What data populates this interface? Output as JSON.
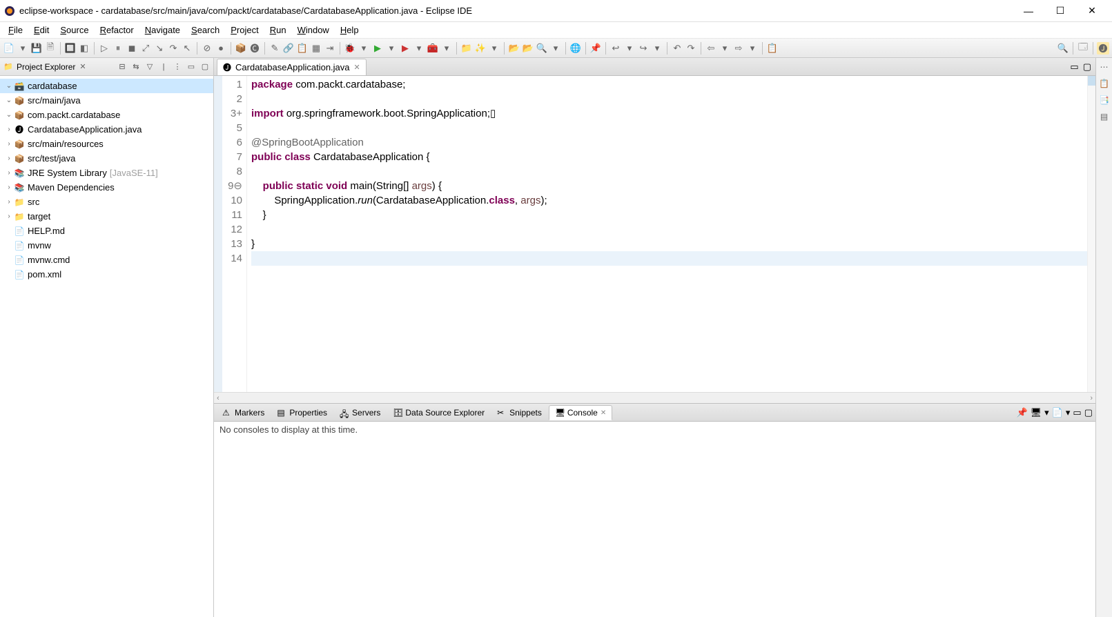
{
  "window": {
    "title": "eclipse-workspace - cardatabase/src/main/java/com/packt/cardatabase/CardatabaseApplication.java - Eclipse IDE"
  },
  "menubar": [
    "File",
    "Edit",
    "Source",
    "Refactor",
    "Navigate",
    "Search",
    "Project",
    "Run",
    "Window",
    "Help"
  ],
  "sidebar": {
    "title": "Project Explorer",
    "nodes": [
      {
        "d": 0,
        "t": "v",
        "icon": "project",
        "label": "cardatabase",
        "sel": true
      },
      {
        "d": 1,
        "t": "v",
        "icon": "srcfolder",
        "label": "src/main/java"
      },
      {
        "d": 2,
        "t": "v",
        "icon": "package",
        "label": "com.packt.cardatabase"
      },
      {
        "d": 3,
        "t": ">",
        "icon": "java",
        "label": "CardatabaseApplication.java"
      },
      {
        "d": 1,
        "t": ">",
        "icon": "srcfolder",
        "label": "src/main/resources"
      },
      {
        "d": 1,
        "t": ">",
        "icon": "srcfolder",
        "label": "src/test/java"
      },
      {
        "d": 1,
        "t": ">",
        "icon": "lib",
        "label": "JRE System Library",
        "decor": "[JavaSE-11]"
      },
      {
        "d": 1,
        "t": ">",
        "icon": "lib",
        "label": "Maven Dependencies"
      },
      {
        "d": 1,
        "t": ">",
        "icon": "folder",
        "label": "src"
      },
      {
        "d": 1,
        "t": ">",
        "icon": "folder",
        "label": "target"
      },
      {
        "d": 1,
        "t": "",
        "icon": "file",
        "label": "HELP.md"
      },
      {
        "d": 1,
        "t": "",
        "icon": "file",
        "label": "mvnw"
      },
      {
        "d": 1,
        "t": "",
        "icon": "file",
        "label": "mvnw.cmd"
      },
      {
        "d": 1,
        "t": "",
        "icon": "file",
        "label": "pom.xml"
      }
    ]
  },
  "editor": {
    "tab": "CardatabaseApplication.java",
    "lines": [
      {
        "n": 1,
        "html": "<span class='kw'>package</span> com.packt.cardatabase;"
      },
      {
        "n": 2,
        "html": ""
      },
      {
        "n": 3,
        "html": "<span class='kw'>import</span> org.springframework.boot.SpringApplication;▯",
        "marker": "+"
      },
      {
        "n": 5,
        "html": ""
      },
      {
        "n": 6,
        "html": "<span class='ann'>@SpringBootApplication</span>"
      },
      {
        "n": 7,
        "html": "<span class='kw'>public</span> <span class='kw'>class</span> CardatabaseApplication {"
      },
      {
        "n": 8,
        "html": ""
      },
      {
        "n": 9,
        "html": "    <span class='kw'>public</span> <span class='kw'>static</span> <span class='kw'>void</span> main(String[] <span class='args'>args</span>) {",
        "marker": "⊖"
      },
      {
        "n": 10,
        "html": "        SpringApplication.<span class='method-italic'>run</span>(CardatabaseApplication.<span class='kw'>class</span>, <span class='args'>args</span>);"
      },
      {
        "n": 11,
        "html": "    }"
      },
      {
        "n": 12,
        "html": ""
      },
      {
        "n": 13,
        "html": "}"
      },
      {
        "n": 14,
        "html": "",
        "cur": true
      }
    ]
  },
  "bottom": {
    "tabs": [
      "Markers",
      "Properties",
      "Servers",
      "Data Source Explorer",
      "Snippets",
      "Console"
    ],
    "active": 5,
    "message": "No consoles to display at this time."
  }
}
